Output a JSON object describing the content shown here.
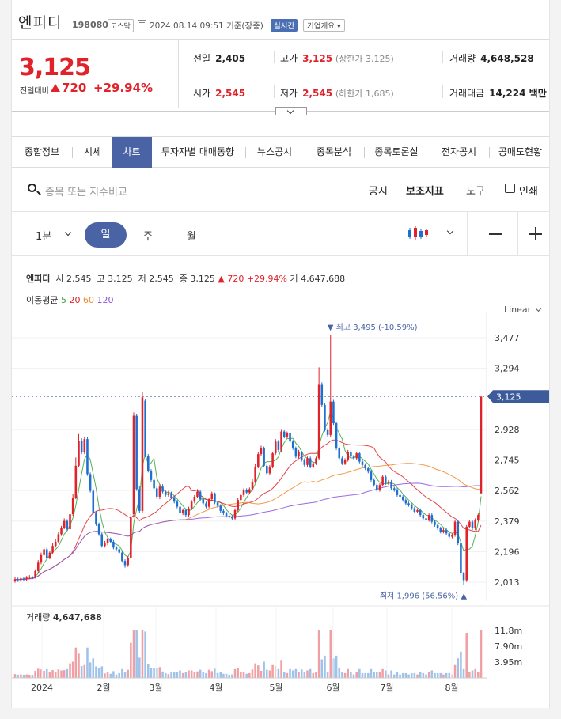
{
  "header": {
    "name": "엔피디",
    "code": "198080",
    "market": "코스닥",
    "datetime": "2024.08.14 09:51",
    "basis": "기준(장중)",
    "realtime": "실시간",
    "company_info": "기업개요"
  },
  "price": {
    "current": "3,125",
    "change_label": "전일대비",
    "change": "720",
    "change_pct": "+29.94%"
  },
  "stats": {
    "prev_label": "전일",
    "prev": "2,405",
    "high_label": "고가",
    "high": "3,125",
    "upper_limit": "(상한가 3,125)",
    "volume_label": "거래량",
    "volume": "4,648,528",
    "open_label": "시가",
    "open": "2,545",
    "low_label": "저가",
    "low": "2,545",
    "lower_limit": "(하한가 1,685)",
    "amount_label": "거래대금",
    "amount": "14,224 백만"
  },
  "tabs": [
    "종합정보",
    "시세",
    "차트",
    "투자자별 매매동향",
    "뉴스공시",
    "종목분석",
    "종목토론실",
    "전자공시",
    "공매도현황"
  ],
  "active_tab": 2,
  "search": {
    "placeholder": "종목 또는 지수비교",
    "links": [
      "공시",
      "보조지표",
      "도구",
      "인쇄"
    ]
  },
  "periods": {
    "minute": "1분",
    "day": "일",
    "week": "주",
    "month": "월"
  },
  "info": {
    "name": "엔피디",
    "open_label": "시",
    "open": "2,545",
    "high_label": "고",
    "high": "3,125",
    "low_label": "저",
    "low": "2,545",
    "close_label": "종",
    "close": "3,125",
    "change": "720",
    "change_pct": "+29.94%",
    "volume_label": "거",
    "volume": "4,647,688",
    "ma_label": "이동평균",
    "ma": [
      {
        "name": "5",
        "color": "#3aa33a"
      },
      {
        "name": "20",
        "color": "#e0222b"
      },
      {
        "name": "60",
        "color": "#f08a2c"
      },
      {
        "name": "120",
        "color": "#8a4fdc"
      }
    ],
    "scale": "Linear"
  },
  "colors": {
    "up": "#e0222b",
    "down": "#1f6fd0",
    "accent": "#4a63a5"
  },
  "chart_data": {
    "type": "candlestick",
    "y_ticks": [
      3477,
      3294,
      2928,
      2745,
      2562,
      2379,
      2196,
      2013
    ],
    "y_tick_labels": [
      "3,477",
      "3,294",
      "2,928",
      "2,745",
      "2,562",
      "2,379",
      "2,196",
      "2,013"
    ],
    "current_label": "3,125",
    "current": 3125,
    "max_label": "▼ 최고 3,495 (-10.59%)",
    "max": 3495,
    "min_label": "최저 1,996 (56.56%) ▲",
    "min": 1996,
    "x_labels": [
      "2024",
      "2월",
      "3월",
      "4월",
      "5월",
      "6월",
      "7월",
      "8월"
    ],
    "volume_title": "거래량",
    "volume_value": "4,647,688",
    "volume_ticks": [
      "11.8m",
      "7.90m",
      "3.95m"
    ],
    "volume_tick_values": [
      11.8,
      7.9,
      3.95
    ],
    "closes": [
      2030,
      2025,
      2035,
      2028,
      2040,
      2045,
      2038,
      2080,
      2130,
      2175,
      2210,
      2160,
      2190,
      2230,
      2255,
      2300,
      2340,
      2380,
      2330,
      2420,
      2520,
      2710,
      2860,
      2790,
      2870,
      2660,
      2560,
      2430,
      2360,
      2300,
      2230,
      2245,
      2270,
      2255,
      2220,
      2210,
      2190,
      2140,
      2115,
      2160,
      2400,
      3010,
      2570,
      2440,
      3120,
      2770,
      2680,
      2625,
      2575,
      2525,
      2585,
      2555,
      2535,
      2545,
      2520,
      2495,
      2465,
      2425,
      2445,
      2415,
      2455,
      2495,
      2525,
      2555,
      2510,
      2485,
      2465,
      2510,
      2545,
      2490,
      2470,
      2440,
      2425,
      2410,
      2405,
      2395,
      2445,
      2505,
      2535,
      2565,
      2550,
      2570,
      2615,
      2705,
      2780,
      2815,
      2710,
      2665,
      2705,
      2785,
      2855,
      2805,
      2915,
      2885,
      2905,
      2855,
      2815,
      2765,
      2795,
      2745,
      2715,
      2755,
      2705,
      2725,
      2755,
      3195,
      3075,
      2925,
      2895,
      3095,
      2965,
      2815,
      2755,
      2725,
      2745,
      2795,
      2765,
      2755,
      2785,
      2735,
      2715,
      2695,
      2675,
      2625,
      2595,
      2565,
      2595,
      2645,
      2605,
      2615,
      2575,
      2565,
      2535,
      2525,
      2505,
      2485,
      2475,
      2455,
      2435,
      2445,
      2415,
      2395,
      2385,
      2415,
      2375,
      2355,
      2335,
      2315,
      2325,
      2305,
      2285,
      2295,
      2375,
      2245,
      2065,
      2025,
      2345,
      2375,
      2335,
      2385,
      2415,
      3125
    ],
    "opens": [
      2020,
      2030,
      2025,
      2035,
      2030,
      2040,
      2045,
      2040,
      2080,
      2130,
      2175,
      2210,
      2160,
      2190,
      2230,
      2255,
      2300,
      2340,
      2380,
      2330,
      2420,
      2520,
      2710,
      2860,
      2790,
      2870,
      2660,
      2560,
      2430,
      2360,
      2300,
      2230,
      2245,
      2270,
      2255,
      2220,
      2210,
      2190,
      2140,
      2115,
      2160,
      2420,
      3010,
      2570,
      2440,
      3100,
      2770,
      2680,
      2625,
      2575,
      2525,
      2585,
      2555,
      2535,
      2545,
      2520,
      2495,
      2465,
      2425,
      2445,
      2415,
      2455,
      2495,
      2525,
      2555,
      2510,
      2485,
      2465,
      2510,
      2545,
      2490,
      2470,
      2440,
      2425,
      2410,
      2405,
      2395,
      2445,
      2505,
      2535,
      2565,
      2550,
      2570,
      2615,
      2705,
      2780,
      2815,
      2710,
      2665,
      2705,
      2785,
      2855,
      2805,
      2915,
      2885,
      2905,
      2855,
      2815,
      2765,
      2795,
      2745,
      2715,
      2755,
      2705,
      2725,
      2755,
      3195,
      3075,
      2925,
      2895,
      3095,
      2965,
      2815,
      2755,
      2725,
      2745,
      2795,
      2765,
      2755,
      2785,
      2735,
      2715,
      2695,
      2675,
      2625,
      2595,
      2565,
      2595,
      2645,
      2605,
      2615,
      2575,
      2565,
      2535,
      2525,
      2505,
      2485,
      2475,
      2455,
      2435,
      2445,
      2415,
      2395,
      2385,
      2415,
      2375,
      2355,
      2335,
      2315,
      2325,
      2305,
      2285,
      2295,
      2375,
      2245,
      2065,
      2025,
      2345,
      2375,
      2335,
      2385,
      2545
    ],
    "highs": [
      2045,
      2040,
      2045,
      2045,
      2050,
      2055,
      2050,
      2090,
      2145,
      2190,
      2225,
      2220,
      2200,
      2245,
      2270,
      2315,
      2350,
      2395,
      2390,
      2435,
      2540,
      2760,
      2900,
      2875,
      2880,
      2880,
      2670,
      2570,
      2440,
      2370,
      2310,
      2260,
      2280,
      2280,
      2265,
      2230,
      2220,
      2200,
      2150,
      2170,
      2420,
      3030,
      3020,
      2590,
      3150,
      3110,
      2780,
      2690,
      2640,
      2590,
      2600,
      2600,
      2565,
      2560,
      2555,
      2530,
      2505,
      2475,
      2455,
      2455,
      2465,
      2505,
      2535,
      2570,
      2565,
      2520,
      2495,
      2520,
      2555,
      2550,
      2500,
      2480,
      2450,
      2435,
      2420,
      2415,
      2455,
      2515,
      2545,
      2575,
      2575,
      2580,
      2630,
      2720,
      2795,
      2830,
      2825,
      2720,
      2715,
      2795,
      2870,
      2865,
      2930,
      2925,
      2915,
      2915,
      2865,
      2825,
      2805,
      2800,
      2755,
      2765,
      2765,
      2735,
      2765,
      3300,
      3210,
      3085,
      2935,
      3495,
      3105,
      2975,
      2825,
      2765,
      2755,
      2805,
      2805,
      2775,
      2795,
      2795,
      2745,
      2725,
      2705,
      2685,
      2635,
      2605,
      2605,
      2655,
      2655,
      2625,
      2625,
      2585,
      2575,
      2545,
      2535,
      2515,
      2495,
      2485,
      2465,
      2455,
      2455,
      2425,
      2405,
      2425,
      2425,
      2385,
      2365,
      2345,
      2335,
      2335,
      2315,
      2305,
      2385,
      2385,
      2255,
      2075,
      2355,
      2385,
      2385,
      2395,
      2425,
      3125
    ],
    "lows": [
      2010,
      2015,
      2015,
      2020,
      2020,
      2030,
      2030,
      2035,
      2070,
      2120,
      2165,
      2150,
      2150,
      2180,
      2220,
      2245,
      2290,
      2330,
      2320,
      2320,
      2410,
      2510,
      2700,
      2780,
      2780,
      2650,
      2550,
      2420,
      2350,
      2290,
      2220,
      2220,
      2235,
      2245,
      2210,
      2200,
      2180,
      2130,
      2100,
      2105,
      2150,
      2400,
      2560,
      2430,
      2430,
      2760,
      2670,
      2610,
      2560,
      2510,
      2510,
      2545,
      2525,
      2525,
      2510,
      2485,
      2455,
      2415,
      2415,
      2405,
      2405,
      2445,
      2485,
      2515,
      2500,
      2475,
      2455,
      2455,
      2500,
      2480,
      2460,
      2430,
      2415,
      2400,
      2395,
      2385,
      2385,
      2435,
      2495,
      2525,
      2540,
      2540,
      2560,
      2605,
      2695,
      2770,
      2700,
      2655,
      2655,
      2695,
      2775,
      2795,
      2795,
      2875,
      2875,
      2845,
      2805,
      2755,
      2755,
      2735,
      2705,
      2705,
      2695,
      2695,
      2715,
      2745,
      3065,
      2915,
      2885,
      2885,
      2955,
      2805,
      2745,
      2715,
      2715,
      2735,
      2755,
      2745,
      2745,
      2725,
      2705,
      2685,
      2665,
      2615,
      2585,
      2555,
      2555,
      2585,
      2595,
      2595,
      2565,
      2555,
      2525,
      2515,
      2495,
      2475,
      2465,
      2445,
      2425,
      2425,
      2405,
      2385,
      2375,
      2375,
      2365,
      2345,
      2325,
      2305,
      2305,
      2295,
      2275,
      2275,
      2285,
      2235,
      2055,
      1996,
      2015,
      2335,
      2325,
      2325,
      2375,
      2545
    ]
  }
}
